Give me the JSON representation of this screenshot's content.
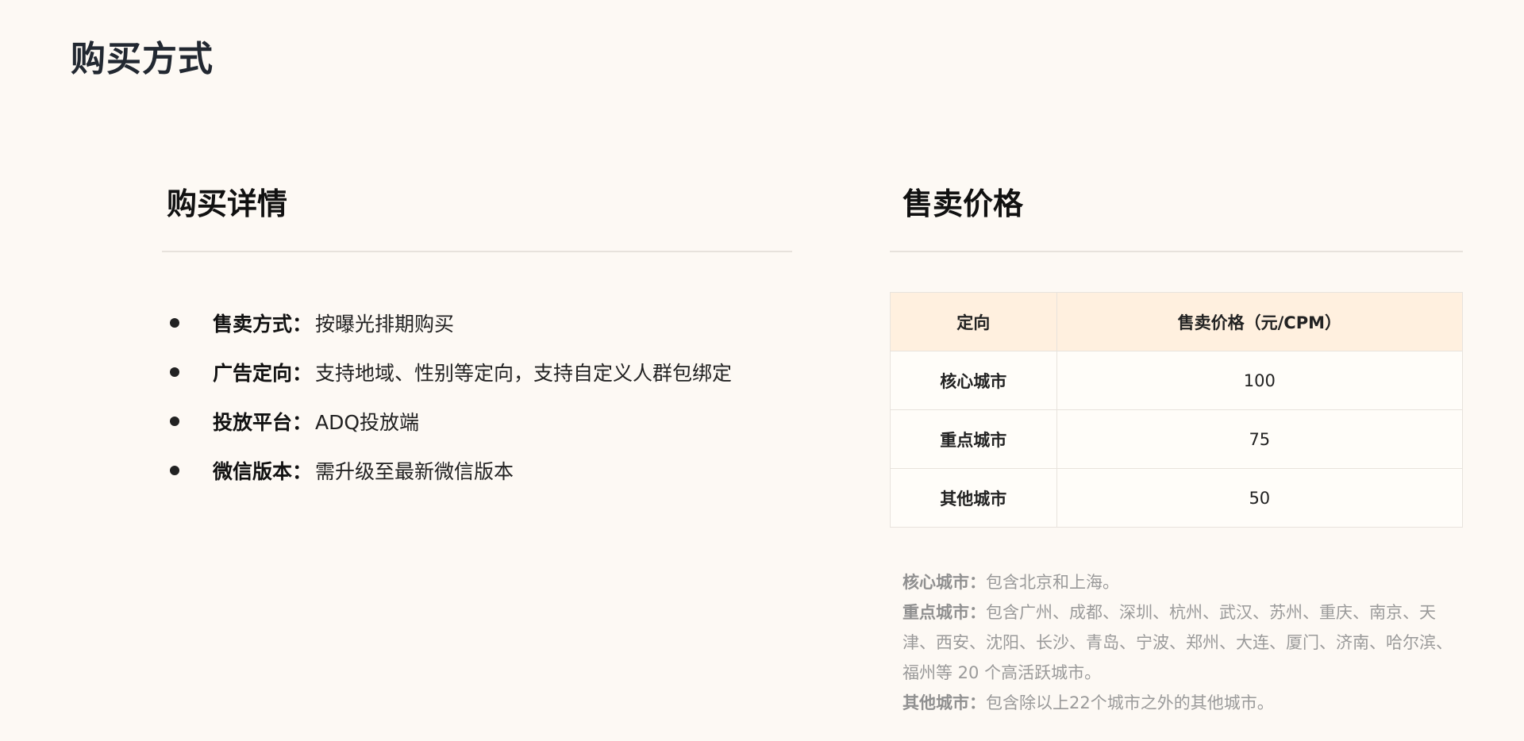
{
  "page": {
    "title": "购买方式"
  },
  "details": {
    "title": "购买详情",
    "items": [
      {
        "label": "售卖方式：",
        "value": "按曝光排期购买"
      },
      {
        "label": "广告定向：",
        "value": "支持地域、性别等定向，支持自定义人群包绑定"
      },
      {
        "label": "投放平台：",
        "value": "ADQ投放端"
      },
      {
        "label": "微信版本：",
        "value": "需升级至最新微信版本"
      }
    ]
  },
  "pricing": {
    "title": "售卖价格",
    "table": {
      "headers": [
        "定向",
        "售卖价格（元/CPM）"
      ],
      "rows": [
        {
          "city": "核心城市",
          "price": "100"
        },
        {
          "city": "重点城市",
          "price": "75"
        },
        {
          "city": "其他城市",
          "price": "50"
        }
      ]
    },
    "notes": [
      {
        "label": "核心城市：",
        "text": "包含北京和上海。"
      },
      {
        "label": "重点城市：",
        "text": "包含广州、成都、深圳、杭州、武汉、苏州、重庆、南京、天津、西安、沈阳、长沙、青岛、宁波、郑州、大连、厦门、济南、哈尔滨、福州等 20 个高活跃城市。"
      },
      {
        "label": "其他城市：",
        "text": "包含除以上22个城市之外的其他城市。"
      }
    ]
  },
  "colors": {
    "background": "#fdf9f4",
    "table_header": "#fff0df",
    "divider": "#e7e2dc",
    "note_text": "#9a9a9a"
  }
}
